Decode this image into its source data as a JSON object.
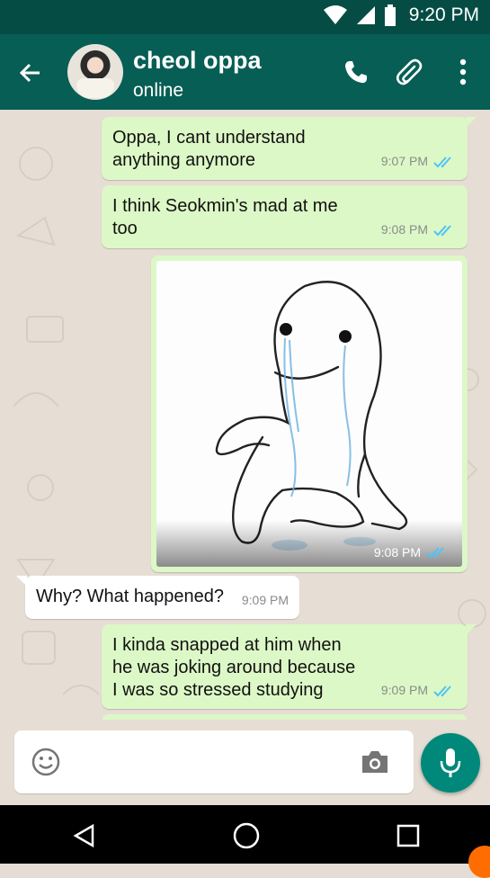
{
  "status_bar": {
    "time": "9:20 PM"
  },
  "header": {
    "contact_name": "cheol oppa",
    "contact_status": "online"
  },
  "messages": [
    {
      "direction": "out",
      "lines": [
        "Oppa, I cant understand",
        "anything anymore"
      ],
      "time": "9:07 PM",
      "status": "read"
    },
    {
      "direction": "out",
      "lines": [
        "I think Seokmin's mad at me",
        "too"
      ],
      "time": "9:08 PM",
      "status": "read"
    },
    {
      "direction": "out",
      "type": "image",
      "time": "9:08 PM",
      "status": "read"
    },
    {
      "direction": "in",
      "lines": [
        "Why? What happened?"
      ],
      "time": "9:09 PM"
    },
    {
      "direction": "out",
      "lines": [
        "I kinda snapped at him when",
        "he was joking around because",
        "I was so stressed studying"
      ],
      "time": "9:09 PM",
      "status": "read"
    }
  ],
  "icons": {
    "back": "arrow-left-icon",
    "call": "phone-icon",
    "attach": "paperclip-icon",
    "menu": "more-vert-icon",
    "emoji": "emoji-icon",
    "camera": "camera-icon",
    "mic": "mic-icon",
    "nav_back": "triangle-back-icon",
    "nav_home": "circle-home-icon",
    "nav_recents": "square-recents-icon"
  },
  "colors": {
    "appbar": "#075e54",
    "statusbar": "#054d44",
    "outgoing_bubble": "#dcf8c6",
    "incoming_bubble": "#ffffff",
    "read_ticks": "#4fc3f7",
    "mic_button": "#00897b"
  }
}
